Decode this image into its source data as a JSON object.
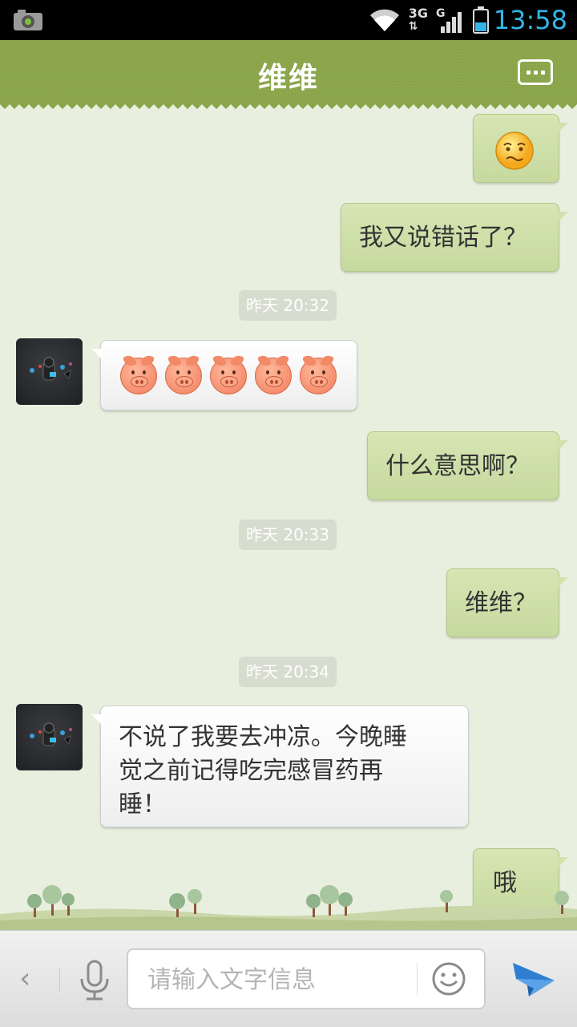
{
  "status_bar": {
    "time": "13:58",
    "icons": [
      "camera-icon",
      "wifi-icon",
      "network-3g-icon",
      "signal-g-icon",
      "battery-icon"
    ],
    "network_label_1": "3G",
    "network_label_2": "G"
  },
  "header": {
    "title": "维维",
    "menu_icon": "more-menu-icon"
  },
  "messages": [
    {
      "side": "right",
      "type": "emoji",
      "emoji": "worried-face"
    },
    {
      "side": "right",
      "type": "text",
      "text": "我又说错话了？"
    },
    {
      "type": "time",
      "text": "昨天 20:32"
    },
    {
      "side": "left",
      "type": "emoji",
      "emoji": "pig-face",
      "count": 5
    },
    {
      "side": "right",
      "type": "text",
      "text": "什么意思啊？"
    },
    {
      "type": "time",
      "text": "昨天 20:33"
    },
    {
      "side": "right",
      "type": "text",
      "text": "维维？"
    },
    {
      "type": "time",
      "text": "昨天 20:34"
    },
    {
      "side": "left",
      "type": "text",
      "lines": [
        "不说了我要去冲凉。今晚睡",
        "觉之前记得吃完感冒药再",
        "睡！"
      ]
    },
    {
      "side": "right",
      "type": "text",
      "text": "哦"
    }
  ],
  "input_bar": {
    "back_glyph": "‹",
    "placeholder": "请输入文字信息",
    "value": ""
  },
  "colors": {
    "header_bg": "#8aa54a",
    "chat_bg": "#e9efdf",
    "right_bubble": "#cfe0a8",
    "left_bubble": "#f4f4f4",
    "time_accent": "#33b5e5",
    "send_icon": "#2e7fd1"
  }
}
